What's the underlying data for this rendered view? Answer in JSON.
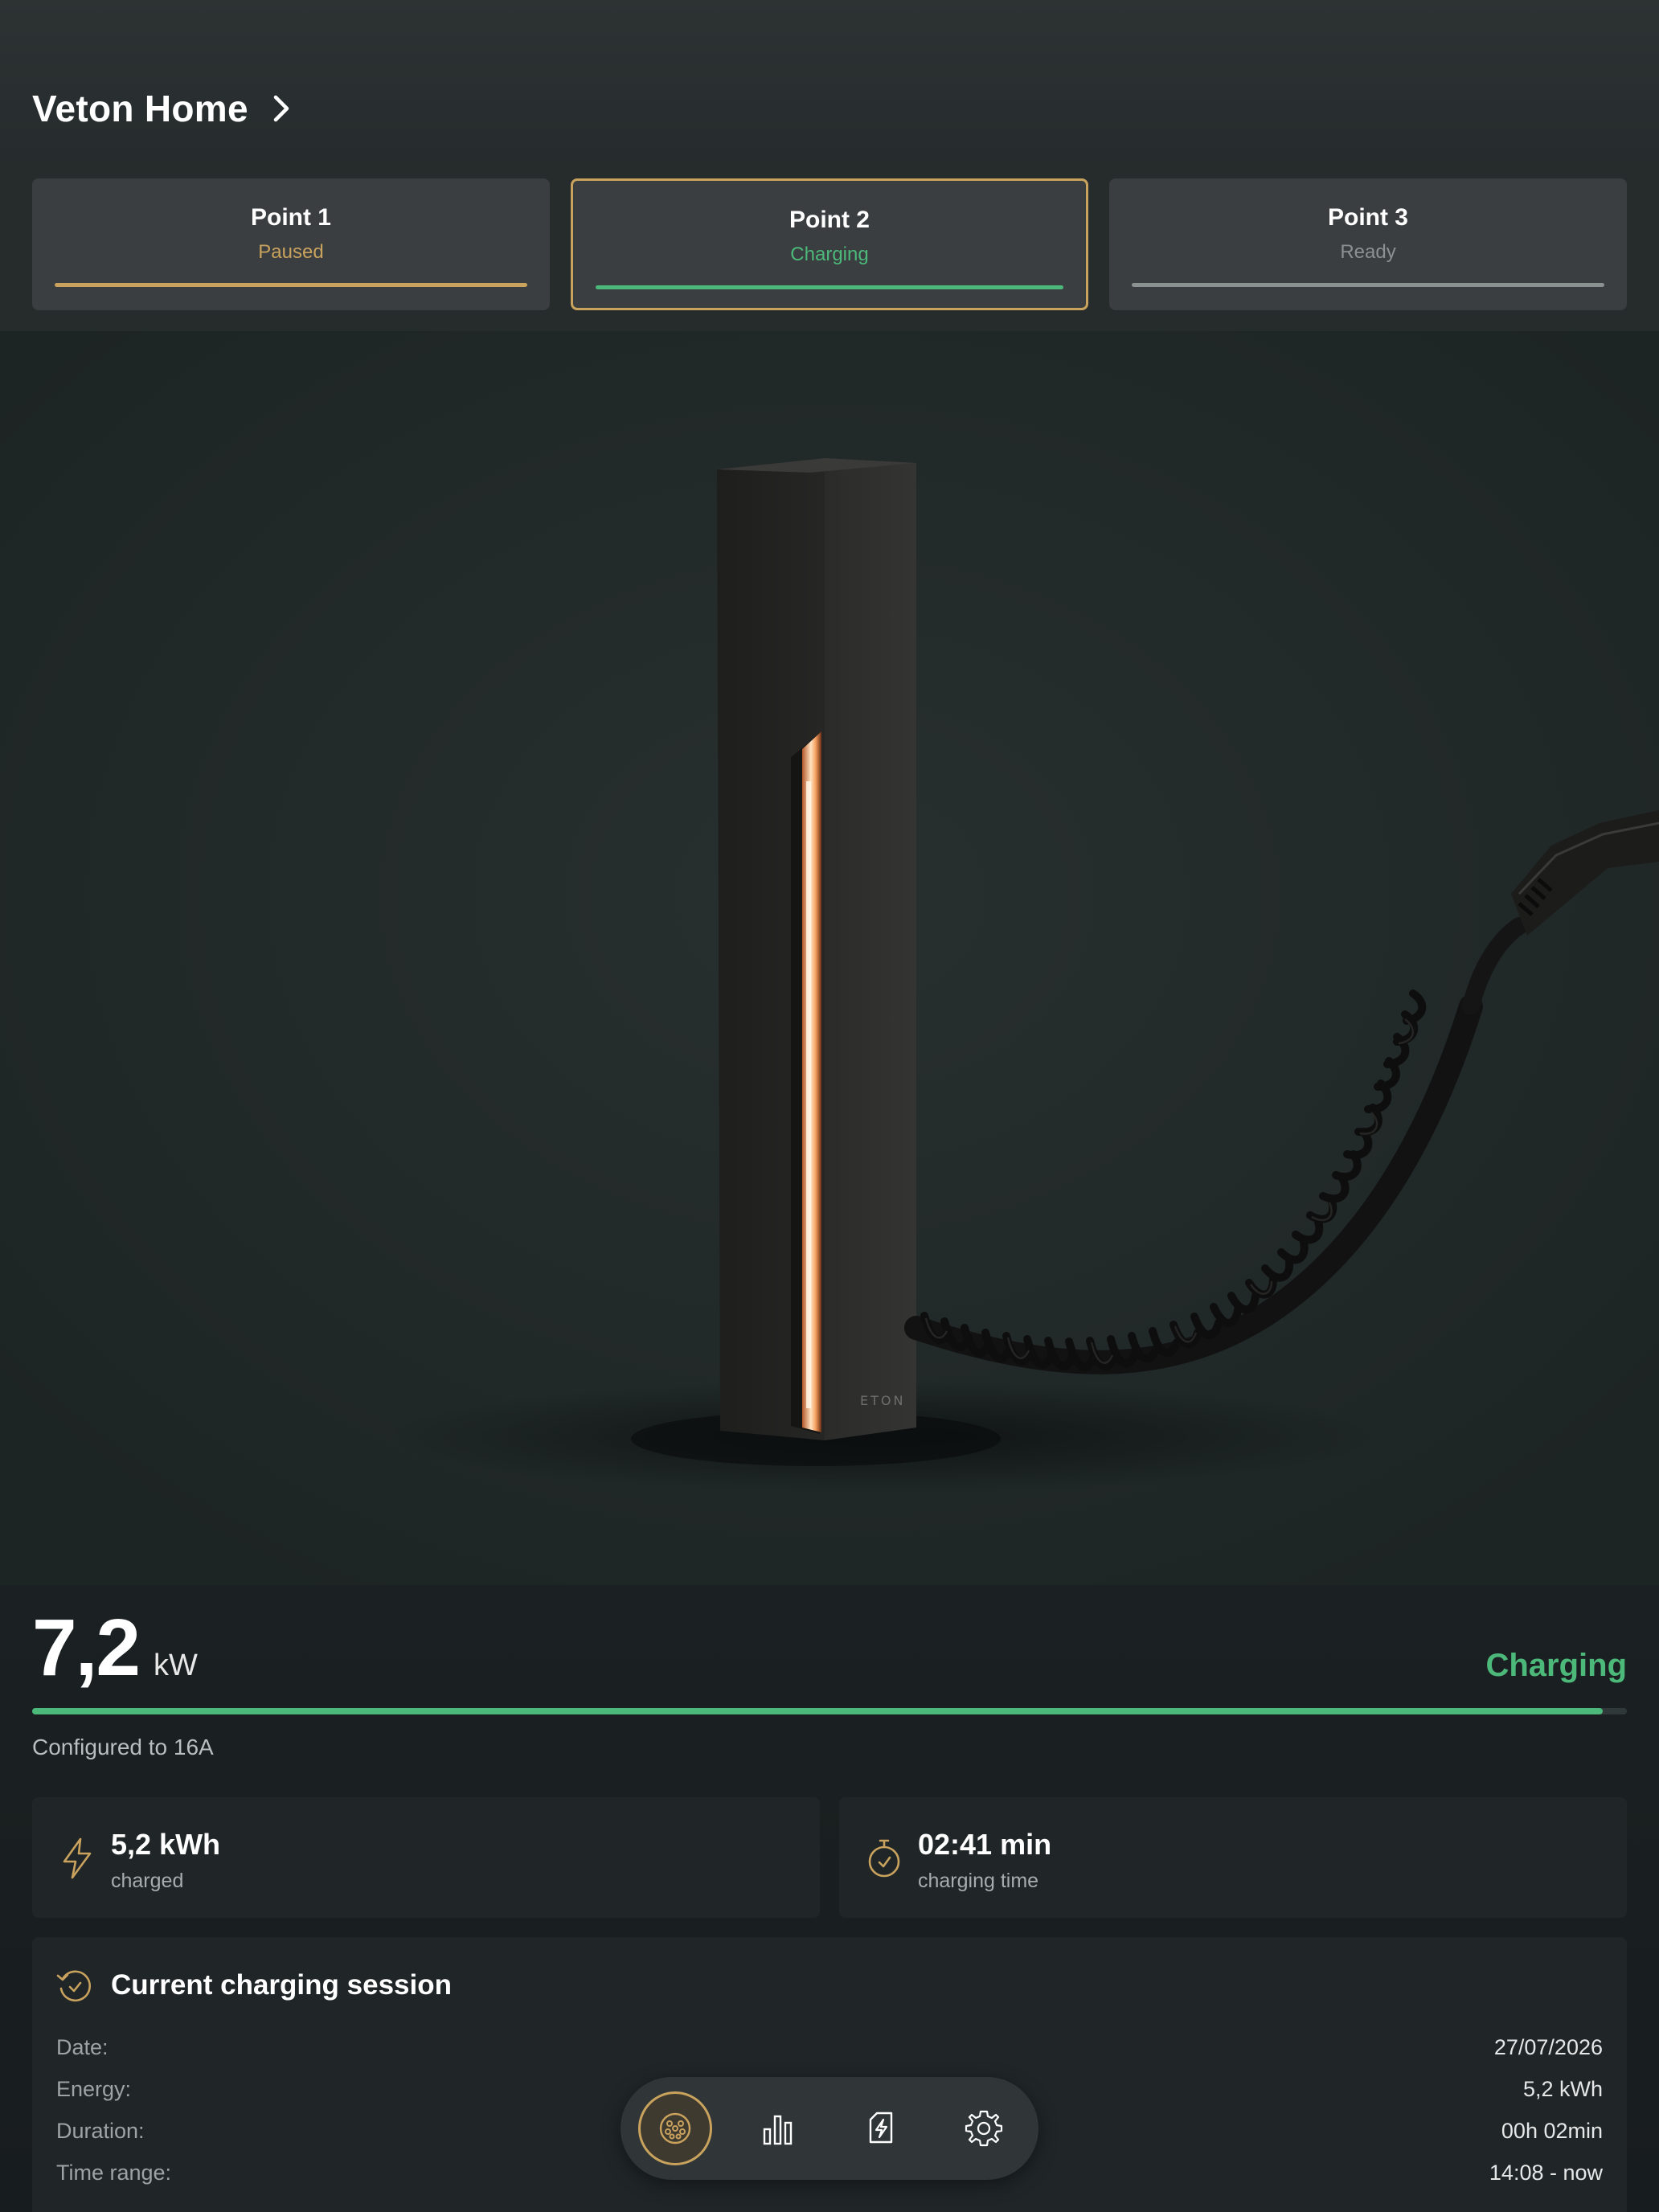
{
  "header": {
    "title": "Veton Home"
  },
  "points": [
    {
      "name": "Point 1",
      "status": "Paused",
      "status_color": "#c9a25d",
      "bar_color": "#c9a25d",
      "selected": false
    },
    {
      "name": "Point 2",
      "status": "Charging",
      "status_color": "#4cb87a",
      "bar_color": "#4cb87a",
      "selected": true
    },
    {
      "name": "Point 3",
      "status": "Ready",
      "status_color": "#8b9091",
      "bar_color": "#8b9091",
      "selected": false
    }
  ],
  "power": {
    "value": "7,2",
    "unit": "kW",
    "state": "Charging",
    "progress": 0.985,
    "configured": "Configured to 16A"
  },
  "stats": [
    {
      "icon": "lightning-icon",
      "value": "5,2 kWh",
      "label": "charged"
    },
    {
      "icon": "stopwatch-icon",
      "value": "02:41 min",
      "label": "charging time"
    }
  ],
  "session": {
    "title": "Current charging session",
    "rows": [
      {
        "key": "Date:",
        "value": "27/07/2026"
      },
      {
        "key": "Energy:",
        "value": "5,2 kWh"
      },
      {
        "key": "Duration:",
        "value": "00h 02min"
      },
      {
        "key": "Time range:",
        "value": "14:08 - now"
      }
    ]
  },
  "nav": {
    "items": [
      {
        "icon": "charger-connector-icon",
        "active": true
      },
      {
        "icon": "bar-chart-icon",
        "active": false
      },
      {
        "icon": "energy-bolt-icon",
        "active": false
      },
      {
        "icon": "gear-icon",
        "active": false
      }
    ]
  },
  "colors": {
    "accent": "#c9a25d",
    "charging": "#4cb87a",
    "ready": "#8b9091"
  }
}
